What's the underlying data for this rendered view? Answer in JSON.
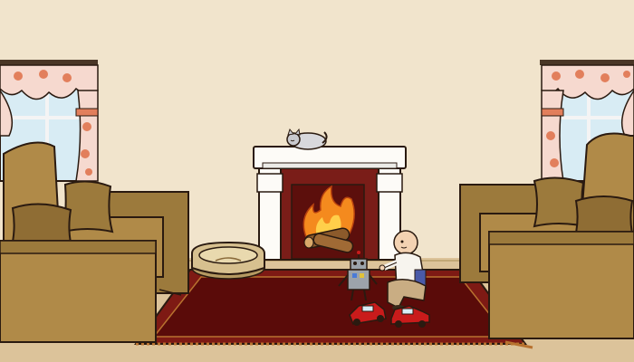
{
  "scene": {
    "colors": {
      "wall": "#f1e4cc",
      "floor": "#dcc39a",
      "rug_outer": "#7e1a14",
      "rug_inner": "#5a0b09",
      "rug_trim": "#b8722f",
      "sofa": "#b08a48",
      "sofa_dark": "#7f6230",
      "sofa_cushion": "#9c7a3c",
      "fireplace_white": "#fdfbf7",
      "fireplace_brick": "#7a1d18",
      "flame": "#f48a1e",
      "curtain": "#f6d9cf",
      "curtain_flower": "#e27f5c",
      "window_sky": "#d8ecf4",
      "toy_car": "#c91b1b",
      "robot": "#9ca3aa",
      "cat": "#d8d8dc",
      "dog_bed": "#d7c08f",
      "outline": "#2a1a10"
    },
    "icons": {
      "cat": "sleeping-cat-icon",
      "robot": "robot-toy-icon",
      "car": "toy-car-icon",
      "fire": "fire-icon",
      "bed": "pet-bed-icon"
    }
  }
}
